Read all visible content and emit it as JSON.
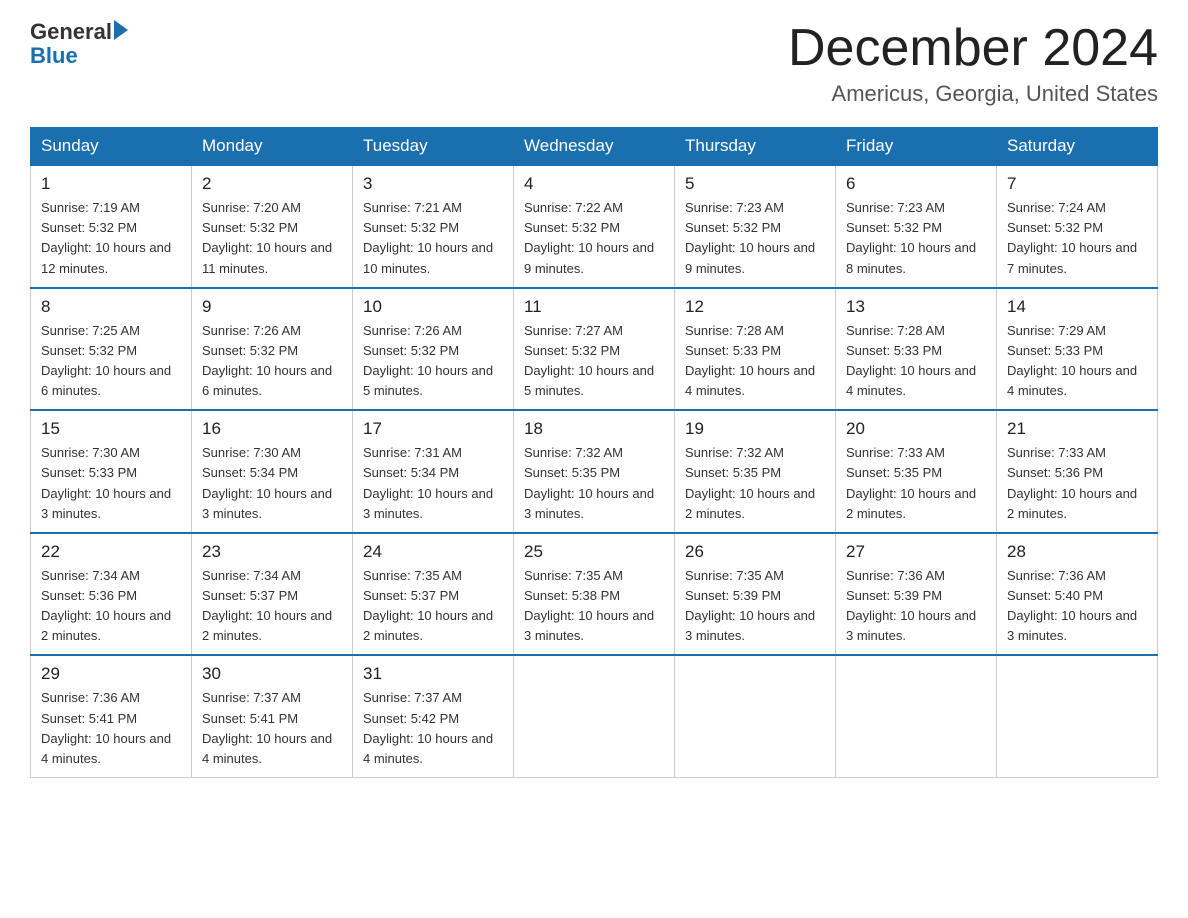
{
  "header": {
    "logo_general": "General",
    "logo_blue": "Blue",
    "title": "December 2024",
    "subtitle": "Americus, Georgia, United States"
  },
  "days_of_week": [
    "Sunday",
    "Monday",
    "Tuesday",
    "Wednesday",
    "Thursday",
    "Friday",
    "Saturday"
  ],
  "weeks": [
    [
      {
        "day": "1",
        "sunrise": "7:19 AM",
        "sunset": "5:32 PM",
        "daylight": "10 hours and 12 minutes."
      },
      {
        "day": "2",
        "sunrise": "7:20 AM",
        "sunset": "5:32 PM",
        "daylight": "10 hours and 11 minutes."
      },
      {
        "day": "3",
        "sunrise": "7:21 AM",
        "sunset": "5:32 PM",
        "daylight": "10 hours and 10 minutes."
      },
      {
        "day": "4",
        "sunrise": "7:22 AM",
        "sunset": "5:32 PM",
        "daylight": "10 hours and 9 minutes."
      },
      {
        "day": "5",
        "sunrise": "7:23 AM",
        "sunset": "5:32 PM",
        "daylight": "10 hours and 9 minutes."
      },
      {
        "day": "6",
        "sunrise": "7:23 AM",
        "sunset": "5:32 PM",
        "daylight": "10 hours and 8 minutes."
      },
      {
        "day": "7",
        "sunrise": "7:24 AM",
        "sunset": "5:32 PM",
        "daylight": "10 hours and 7 minutes."
      }
    ],
    [
      {
        "day": "8",
        "sunrise": "7:25 AM",
        "sunset": "5:32 PM",
        "daylight": "10 hours and 6 minutes."
      },
      {
        "day": "9",
        "sunrise": "7:26 AM",
        "sunset": "5:32 PM",
        "daylight": "10 hours and 6 minutes."
      },
      {
        "day": "10",
        "sunrise": "7:26 AM",
        "sunset": "5:32 PM",
        "daylight": "10 hours and 5 minutes."
      },
      {
        "day": "11",
        "sunrise": "7:27 AM",
        "sunset": "5:32 PM",
        "daylight": "10 hours and 5 minutes."
      },
      {
        "day": "12",
        "sunrise": "7:28 AM",
        "sunset": "5:33 PM",
        "daylight": "10 hours and 4 minutes."
      },
      {
        "day": "13",
        "sunrise": "7:28 AM",
        "sunset": "5:33 PM",
        "daylight": "10 hours and 4 minutes."
      },
      {
        "day": "14",
        "sunrise": "7:29 AM",
        "sunset": "5:33 PM",
        "daylight": "10 hours and 4 minutes."
      }
    ],
    [
      {
        "day": "15",
        "sunrise": "7:30 AM",
        "sunset": "5:33 PM",
        "daylight": "10 hours and 3 minutes."
      },
      {
        "day": "16",
        "sunrise": "7:30 AM",
        "sunset": "5:34 PM",
        "daylight": "10 hours and 3 minutes."
      },
      {
        "day": "17",
        "sunrise": "7:31 AM",
        "sunset": "5:34 PM",
        "daylight": "10 hours and 3 minutes."
      },
      {
        "day": "18",
        "sunrise": "7:32 AM",
        "sunset": "5:35 PM",
        "daylight": "10 hours and 3 minutes."
      },
      {
        "day": "19",
        "sunrise": "7:32 AM",
        "sunset": "5:35 PM",
        "daylight": "10 hours and 2 minutes."
      },
      {
        "day": "20",
        "sunrise": "7:33 AM",
        "sunset": "5:35 PM",
        "daylight": "10 hours and 2 minutes."
      },
      {
        "day": "21",
        "sunrise": "7:33 AM",
        "sunset": "5:36 PM",
        "daylight": "10 hours and 2 minutes."
      }
    ],
    [
      {
        "day": "22",
        "sunrise": "7:34 AM",
        "sunset": "5:36 PM",
        "daylight": "10 hours and 2 minutes."
      },
      {
        "day": "23",
        "sunrise": "7:34 AM",
        "sunset": "5:37 PM",
        "daylight": "10 hours and 2 minutes."
      },
      {
        "day": "24",
        "sunrise": "7:35 AM",
        "sunset": "5:37 PM",
        "daylight": "10 hours and 2 minutes."
      },
      {
        "day": "25",
        "sunrise": "7:35 AM",
        "sunset": "5:38 PM",
        "daylight": "10 hours and 3 minutes."
      },
      {
        "day": "26",
        "sunrise": "7:35 AM",
        "sunset": "5:39 PM",
        "daylight": "10 hours and 3 minutes."
      },
      {
        "day": "27",
        "sunrise": "7:36 AM",
        "sunset": "5:39 PM",
        "daylight": "10 hours and 3 minutes."
      },
      {
        "day": "28",
        "sunrise": "7:36 AM",
        "sunset": "5:40 PM",
        "daylight": "10 hours and 3 minutes."
      }
    ],
    [
      {
        "day": "29",
        "sunrise": "7:36 AM",
        "sunset": "5:41 PM",
        "daylight": "10 hours and 4 minutes."
      },
      {
        "day": "30",
        "sunrise": "7:37 AM",
        "sunset": "5:41 PM",
        "daylight": "10 hours and 4 minutes."
      },
      {
        "day": "31",
        "sunrise": "7:37 AM",
        "sunset": "5:42 PM",
        "daylight": "10 hours and 4 minutes."
      },
      null,
      null,
      null,
      null
    ]
  ],
  "labels": {
    "sunrise_prefix": "Sunrise: ",
    "sunset_prefix": "Sunset: ",
    "daylight_prefix": "Daylight: "
  }
}
